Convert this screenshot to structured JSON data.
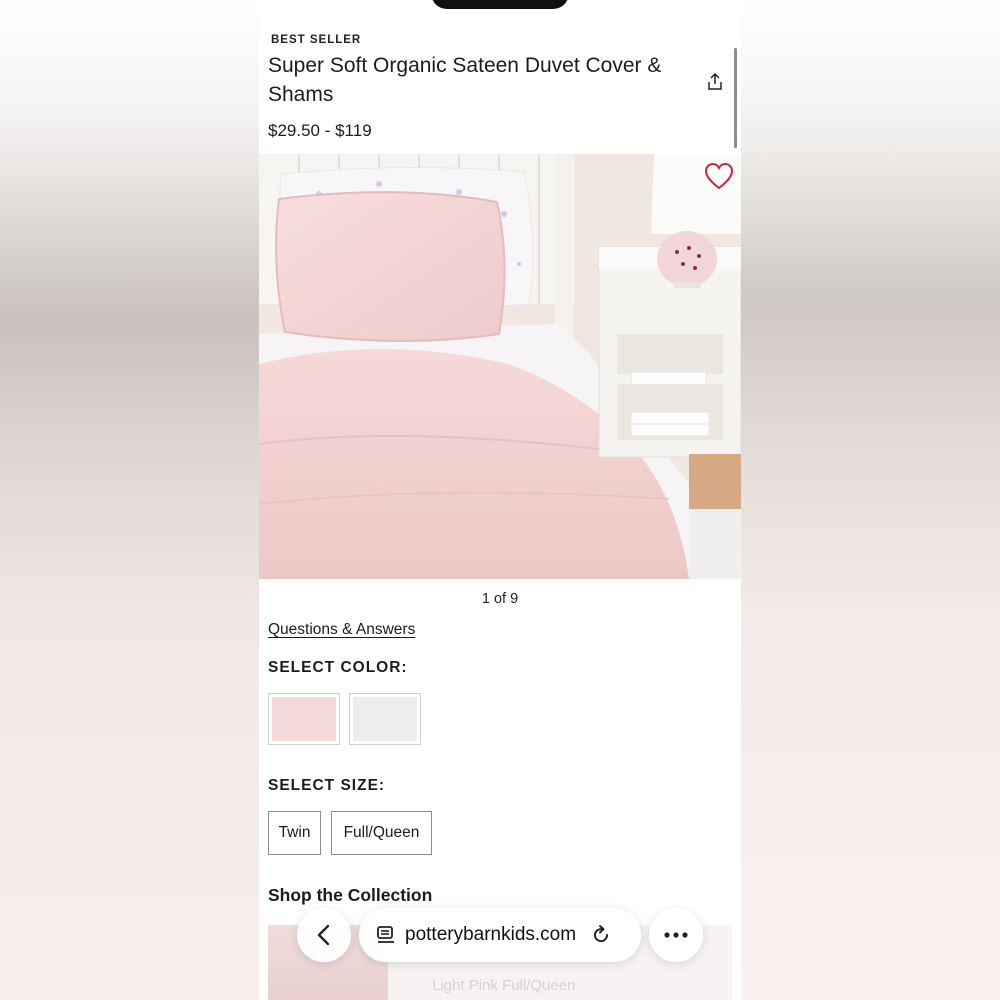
{
  "product": {
    "badge": "BEST SELLER",
    "title": "Super Soft Organic Sateen Duvet Cover & Shams",
    "price": "$29.50 - $119"
  },
  "gallery": {
    "counter": "1 of 9"
  },
  "links": {
    "qa": "Questions & Answers"
  },
  "color_select": {
    "label": "SELECT COLOR:",
    "swatches": [
      {
        "color": "#f6dada"
      },
      {
        "color": "#ededed"
      }
    ]
  },
  "size_select": {
    "label": "SELECT SIZE:",
    "options": [
      "Twin",
      "Full/Queen"
    ]
  },
  "collection": {
    "title": "Shop the Collection",
    "peek_subtitle": "Light Pink  Full/Queen"
  },
  "browser": {
    "url": "potterybarnkids.com"
  },
  "icons": [
    "share-icon",
    "heart-icon",
    "chevron-left-icon",
    "site-icon",
    "reload-icon",
    "more-icon"
  ]
}
